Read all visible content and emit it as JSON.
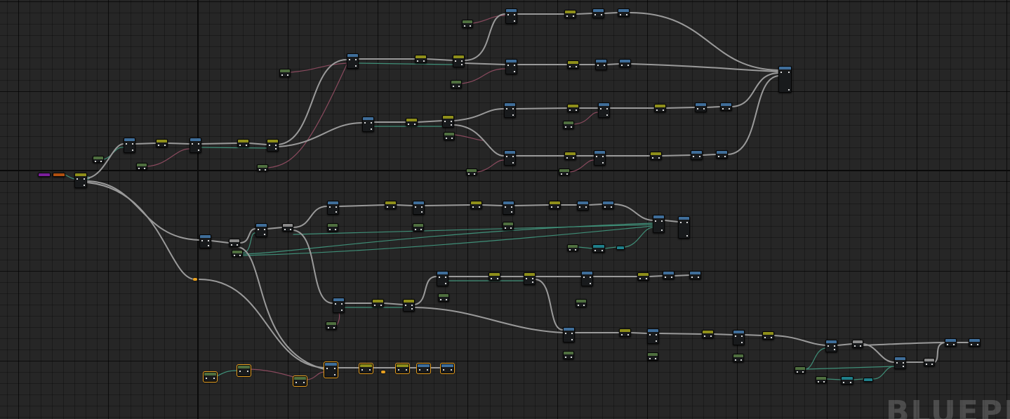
{
  "editor": {
    "watermark": "BLUEPRINT"
  },
  "palette": {
    "grid_background": "#262626",
    "exec_wire": "#9a9a9a",
    "data_wire_green": "#3f8f78",
    "data_wire_pink": "#8a4a5e",
    "selection": "#e8a020",
    "header_blue": "#3f6e9a",
    "header_olive": "#8f8f1a",
    "header_green": "#4f6f3f",
    "header_gray": "#8a8a8a",
    "header_teal": "#1f7f8a",
    "header_purple": "#7a1f9a",
    "header_orange": "#b05010"
  },
  "node_kinds": [
    "event",
    "function",
    "variable-get",
    "variable-set",
    "cast",
    "reroute"
  ],
  "wire_kinds": [
    "exec",
    "data-green",
    "data-pink"
  ]
}
